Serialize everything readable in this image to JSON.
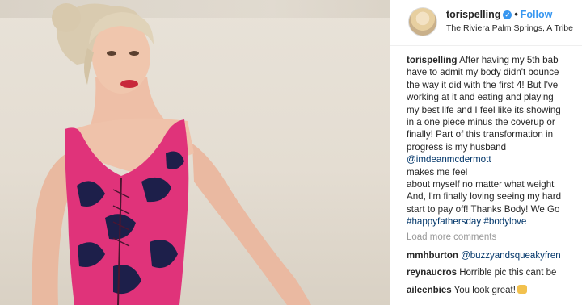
{
  "post": {
    "username": "torispelling",
    "verified_glyph": "✓",
    "separator": "•",
    "follow_label": "Follow",
    "location": "The Riviera Palm Springs, A Tribe",
    "caption_lines": [
      "After having my 5th bab",
      "have to admit my body didn't bounce",
      "the way it did with the first 4! But I've",
      "working at it and eating and playing",
      "my best life and I feel like its showing",
      "in a one piece minus the coverup or",
      "finally! Part of this transformation in",
      "progress is my husband",
      "makes me feel",
      "about myself no matter what weight",
      "And, I'm finally loving seeing my hard",
      "start to pay off! Thanks Body! We Go"
    ],
    "caption_mention": "@imdeanmcdermott",
    "hashtags": [
      "#happyfathersday",
      "#bodylove"
    ],
    "load_more_label": "Load more comments"
  },
  "comments": [
    {
      "user": "mmhburton",
      "text": "@buzzyandsqueakyfren"
    },
    {
      "user": "reynaucros",
      "text": "Horrible pic this cant be"
    },
    {
      "user": "aileenbies",
      "text": "You look great!"
    }
  ],
  "colors": {
    "link_blue": "#3897f0",
    "mention_blue": "#003569",
    "swimsuit_pink": "#e0337a",
    "swimsuit_navy": "#1d1f4a"
  },
  "icons": {
    "verified": "verified-badge-icon",
    "emoji": "emoji-icon"
  }
}
